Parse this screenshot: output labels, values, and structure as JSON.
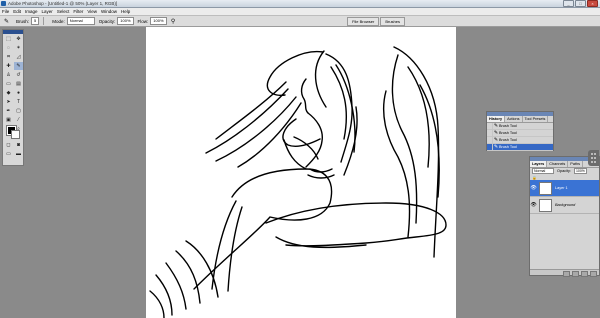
{
  "window": {
    "title": "Adobe Photoshop - [Untitled-1 @ 50% (Layer 1, RGB)]",
    "buttons": [
      "_",
      "□",
      "×"
    ]
  },
  "menu": [
    "File",
    "Edit",
    "Image",
    "Layer",
    "Select",
    "Filter",
    "View",
    "Window",
    "Help"
  ],
  "options": {
    "brush_label": "Brush:",
    "brush_size": "5",
    "mode_label": "Mode:",
    "mode_value": "Normal",
    "opacity_label": "Opacity:",
    "opacity_value": "100%",
    "flow_label": "Flow:",
    "flow_value": "100%"
  },
  "well_tabs": [
    "File Browser",
    "Brushes"
  ],
  "history": {
    "tabs": [
      "History",
      "Actions",
      "Tool Presets"
    ],
    "items": [
      "Brush Tool",
      "Brush Tool",
      "Brush Tool",
      "Brush Tool"
    ],
    "selected_index": 3
  },
  "layers": {
    "tabs": [
      "Layers",
      "Channels",
      "Paths"
    ],
    "blend_mode": "Normal",
    "opacity_label": "Opacity:",
    "opacity_value": "100%",
    "rows": [
      {
        "name": "Layer 1",
        "selected": true
      },
      {
        "name": "Background",
        "selected": false
      }
    ]
  },
  "colors": {
    "foreground": "#000000",
    "background": "#ffffff",
    "selection": "#3a73d4",
    "workspace": "#8a8a8a"
  }
}
